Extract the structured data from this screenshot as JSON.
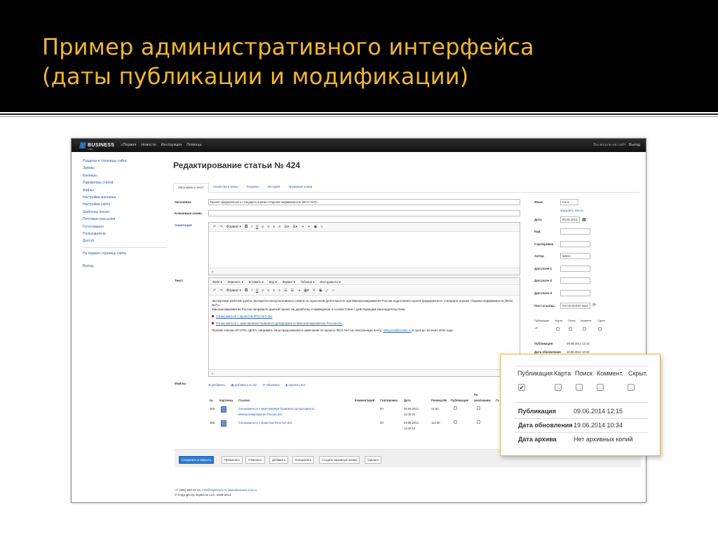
{
  "slide": {
    "title_line1": "Пример административного интерфейса",
    "title_line2": "(даты публикации и модификации)",
    "title_color": "#f0b632"
  },
  "navbar": {
    "brand": "BUSINESS",
    "brand_sub": "ONE",
    "items": [
      "Первая",
      "Новости",
      "Инструкция",
      "Помощь"
    ],
    "status": "Вы вошли на сайт",
    "logout": "Выход"
  },
  "sidebar": {
    "items": [
      "Разделы и страницы сайта",
      "Заказы",
      "Баннеры",
      "Параметры статей",
      "Файлы",
      "Настройки магазина",
      "Настройки сайта",
      "Шаблоны писем",
      "Почтовые рассылки",
      "Голосования",
      "Пользователи",
      "Доступ"
    ],
    "link_home": "На первую страницу сайта",
    "logout": "Выход"
  },
  "page": {
    "title": "Редактирование статьи № 424"
  },
  "tabs": [
    "Заголовок и текст",
    "Свойства и цены",
    "Разделы",
    "История",
    "Архивные копии"
  ],
  "form": {
    "title_label": "Заголовок",
    "title_value": "Проект федерального стандарта оценки «Оценка недвижимости (ФСО №7)»",
    "keywords_label": "Ключевые слова",
    "annotation_label": "Аннотация",
    "text_label": "Текст",
    "files_label": "Файлы"
  },
  "editor": {
    "menu": [
      "Файл ▾",
      "Изменить ▾",
      "Вставить ▾",
      "Вид ▾",
      "Формат ▾",
      "Таблица ▾",
      "Инструменты ▾"
    ],
    "format_label": "Формат ▾",
    "status_p": "p",
    "body": {
      "para1": "Экспертами рабочей группы Экспертно-консультативного совета по оценочной деятельности при Минэкономразвития России подготовлен проект федерального стандарта оценки «Оценка недвижимости (ФСО №7)».",
      "para1b": "Минэкономразвития России направило данный проект на доработку и приведение в соответствие с действующим законодательством.",
      "link1": "Ознакомиться с проектом ФСО №7.doc",
      "link2": "Ознакомиться с замечаниями Правового департамента Минэкономразвития России.doc",
      "para2": "Просим членов НП СРО «ДСО» направить свои предложения и замечания по проекту ФСО №7 на электронную почту:",
      "email": "isheyova@srodso.ru",
      "para2b": "в срок до 16 июня 2014 года."
    }
  },
  "right": {
    "lang_label": "Язык",
    "lang_value": "rus ▾",
    "load_texts": "Загрузить тексты",
    "date_label": "Дата",
    "date_value": "09.06.2014",
    "code_label": "Код",
    "sort_label": "Сортировка",
    "author_label": "Автор",
    "author_value": "admin",
    "field1": "Доп.поле-1",
    "field2": "Доп.поле-2",
    "field3": "Доп.поле-3",
    "permalink_label": "Пост.ссылка",
    "permalink_value": "/01.02.01/424.aspx",
    "flags": [
      "Публикация",
      "Карта",
      "Поиск",
      "Коммент.",
      "Скрыт."
    ],
    "pub_label": "Публикация",
    "pub_value": "09.06.2014 12:15",
    "upd_label": "Дата обновления",
    "upd_value": "19.06.2014 10:34"
  },
  "files": {
    "actions": [
      "Добавить",
      "Добавить из zip",
      "Обновить",
      "Удалить все"
    ],
    "headers": [
      "№",
      "Картинка",
      "Ссылка",
      "Комментарий",
      "Сортировка",
      "Дата",
      "Размер,КБ",
      "Публикация",
      "По умолчанию",
      "Га"
    ],
    "rows": [
      {
        "num": "369",
        "link1": "Ознакомиться с замечаниями Правового департамента",
        "link2": "Минэкономразвития России.doc",
        "sort": "00",
        "date1": "09.06.2014",
        "date2": "12:15:23",
        "size": "41.50"
      },
      {
        "num": "368",
        "link1": "Ознакомиться с проектом ФСО №7.doc",
        "link2": "",
        "sort": "00",
        "date1": "09.06.2014",
        "date2": "12:15:15",
        "size": "110.00"
      }
    ]
  },
  "buttons": [
    "Сохранить и закрыть",
    "Применить",
    "Отменить",
    "Добавить",
    "Копировать",
    "Создать архивную копию",
    "Удалить"
  ],
  "footer": {
    "line1": "+7 (495) 943-42-43,",
    "email": "info@implecom.ru",
    "site": "www.business-one.ru",
    "line2": "© Copyright by Implecom LLC, 2009-2014"
  },
  "zoom": {
    "flags": [
      "Публикация",
      "Карта",
      "Поиск",
      "Коммент.",
      "Скрыт."
    ],
    "pub_label": "Публикация",
    "pub_value": "09.06.2014 12:15",
    "upd_label": "Дата обновления",
    "upd_value": "19.06.2014 10:34",
    "arch_label": "Дата архива",
    "arch_value": "Нет архивных копий"
  }
}
